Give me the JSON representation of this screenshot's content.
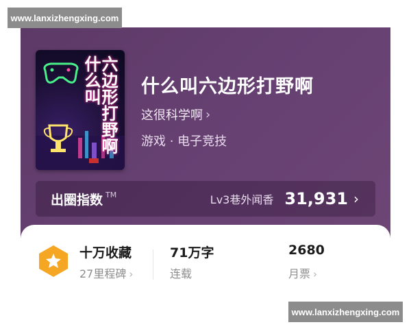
{
  "watermarks": {
    "top": "www.lanxizhengxing.com",
    "bottom": "www.lanxizhengxing.com"
  },
  "book": {
    "cover_title": "六边形打野啊什么叫",
    "title": "什么叫六边形打野啊",
    "author": "这很科学啊",
    "category": "游戏 · 电子竞技"
  },
  "index": {
    "label": "出圈指数",
    "tm": "TM",
    "level": "Lv3巷外闻香",
    "value": "31,931"
  },
  "stats": {
    "favorites": {
      "value": "十万收藏",
      "label": "27里程碑"
    },
    "words": {
      "value": "71万字",
      "label": "连载"
    },
    "votes": {
      "value": "2680",
      "label": "月票"
    }
  },
  "icons": {
    "chevron": "›",
    "badge": "star-badge-icon"
  },
  "colors": {
    "hero": "#654071",
    "badge": "#f5a623"
  }
}
